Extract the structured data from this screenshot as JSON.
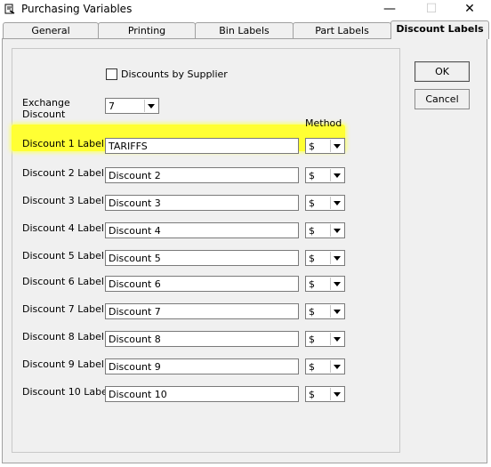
{
  "window": {
    "title": "Purchasing Variables",
    "minimize_glyph": "—",
    "maximize_glyph": "☐",
    "close_glyph": "✕"
  },
  "tabs": [
    {
      "label": "General",
      "active": false
    },
    {
      "label": "Printing",
      "active": false
    },
    {
      "label": "Bin Labels",
      "active": false
    },
    {
      "label": "Part Labels",
      "active": false
    },
    {
      "label": "Discount Labels",
      "active": true
    }
  ],
  "form": {
    "discounts_by_supplier_label": "Discounts by Supplier",
    "discounts_by_supplier_checked": false,
    "exchange_discount_label_line1": "Exchange",
    "exchange_discount_label_line2": "Discount",
    "exchange_discount_value": "7",
    "method_header": "Method",
    "rows": [
      {
        "label": "Discount 1 Label",
        "value": "TARIFFS",
        "method": "$"
      },
      {
        "label": "Discount 2 Label",
        "value": "Discount 2",
        "method": "$"
      },
      {
        "label": "Discount 3 Label",
        "value": "Discount 3",
        "method": "$"
      },
      {
        "label": "Discount 4 Label",
        "value": "Discount 4",
        "method": "$"
      },
      {
        "label": "Discount 5 Label",
        "value": "Discount 5",
        "method": "$"
      },
      {
        "label": "Discount 6 Label",
        "value": "Discount 6",
        "method": "$"
      },
      {
        "label": "Discount 7 Label",
        "value": "Discount 7",
        "method": "$"
      },
      {
        "label": "Discount 8 Label",
        "value": "Discount 8",
        "method": "$"
      },
      {
        "label": "Discount 9 Label",
        "value": "Discount 9",
        "method": "$"
      },
      {
        "label": "Discount 10 Label",
        "value": "Discount 10",
        "method": "$"
      }
    ]
  },
  "buttons": {
    "ok": "OK",
    "cancel": "Cancel"
  },
  "colors": {
    "highlight": "#ffff33",
    "panel_bg": "#f0f0f0"
  }
}
